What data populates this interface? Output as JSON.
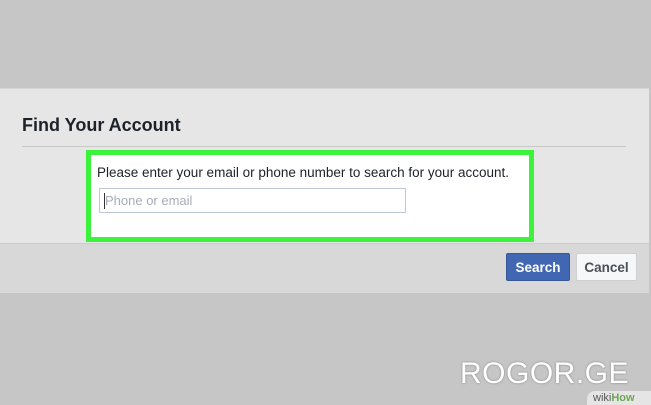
{
  "dialog": {
    "title": "Find Your Account",
    "instruction": "Please enter your email or phone number to search for your account.",
    "input": {
      "value": "",
      "placeholder": "Phone or email"
    },
    "buttons": {
      "search_label": "Search",
      "cancel_label": "Cancel"
    }
  },
  "colors": {
    "highlight": "#3df23d",
    "primary_button": "#4267b2"
  },
  "watermark": {
    "text": "ROGOR.GE",
    "wiki": "wiki",
    "how": "How"
  }
}
